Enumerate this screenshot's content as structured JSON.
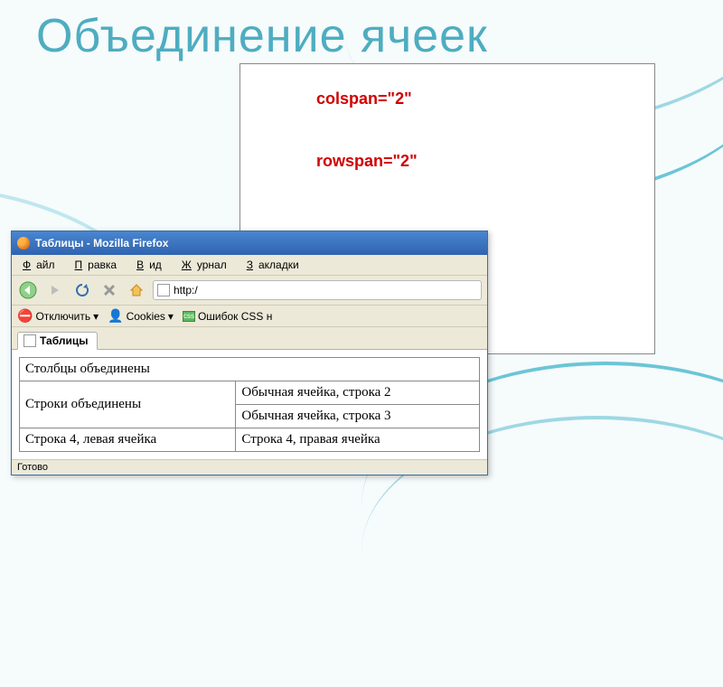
{
  "slide_title": "Объединение ячеек",
  "annotations": {
    "colspan": "colspan=\"2\"",
    "rowspan": "rowspan=\"2\""
  },
  "browser": {
    "window_title": "Таблицы - Mozilla Firefox",
    "menu": {
      "file": "Файл",
      "edit": "Правка",
      "view": "Вид",
      "history": "Журнал",
      "bookmarks": "Закладки"
    },
    "address": "http:/",
    "devbar": {
      "disable": "Отключить",
      "dropdown_glyph": "▾",
      "cookies": "Cookies",
      "csserrors": "Ошибок CSS н"
    },
    "tab_label": "Таблицы",
    "table": {
      "r1c1": "Столбцы объединены",
      "r2c1": "Строки объединены",
      "r2c2": "Обычная ячейка, строка 2",
      "r3c2": "Обычная ячейка, строка 3",
      "r4c1": "Строка 4, левая ячейка",
      "r4c2": "Строка 4, правая ячейка"
    },
    "status": "Готово"
  }
}
